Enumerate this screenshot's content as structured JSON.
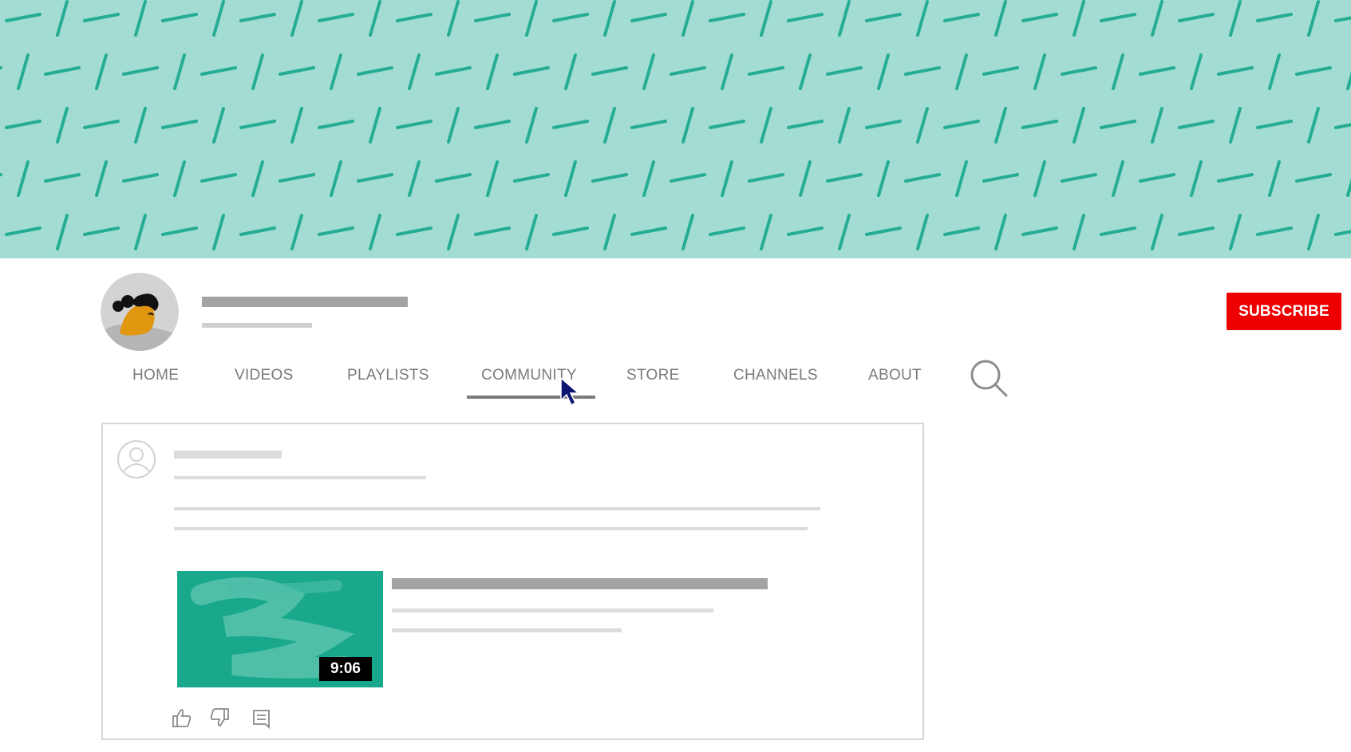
{
  "banner": {
    "background_color": "#a2dcd2",
    "stroke_color": "#25ad93"
  },
  "channel": {
    "avatar_icon": "person-avatar-icon",
    "subscribe_label": "SUBSCRIBE",
    "subscribe_color": "#ee0000"
  },
  "tabs": [
    {
      "label": "HOME",
      "active": false
    },
    {
      "label": "VIDEOS",
      "active": false
    },
    {
      "label": "PLAYLISTS",
      "active": false
    },
    {
      "label": "COMMUNITY",
      "active": true
    },
    {
      "label": "STORE",
      "active": false
    },
    {
      "label": "CHANNELS",
      "active": false
    },
    {
      "label": "ABOUT",
      "active": false
    }
  ],
  "search": {
    "icon": "search-icon"
  },
  "post": {
    "author_icon": "user-avatar-icon",
    "video": {
      "duration": "9:06",
      "thumbnail_color": "#1aa88d"
    },
    "actions": {
      "like_icon": "thumbs-up-icon",
      "dislike_icon": "thumbs-down-icon",
      "comment_icon": "comment-icon"
    }
  },
  "cursor": {
    "icon": "mouse-pointer-icon",
    "color": "#0b1570"
  }
}
